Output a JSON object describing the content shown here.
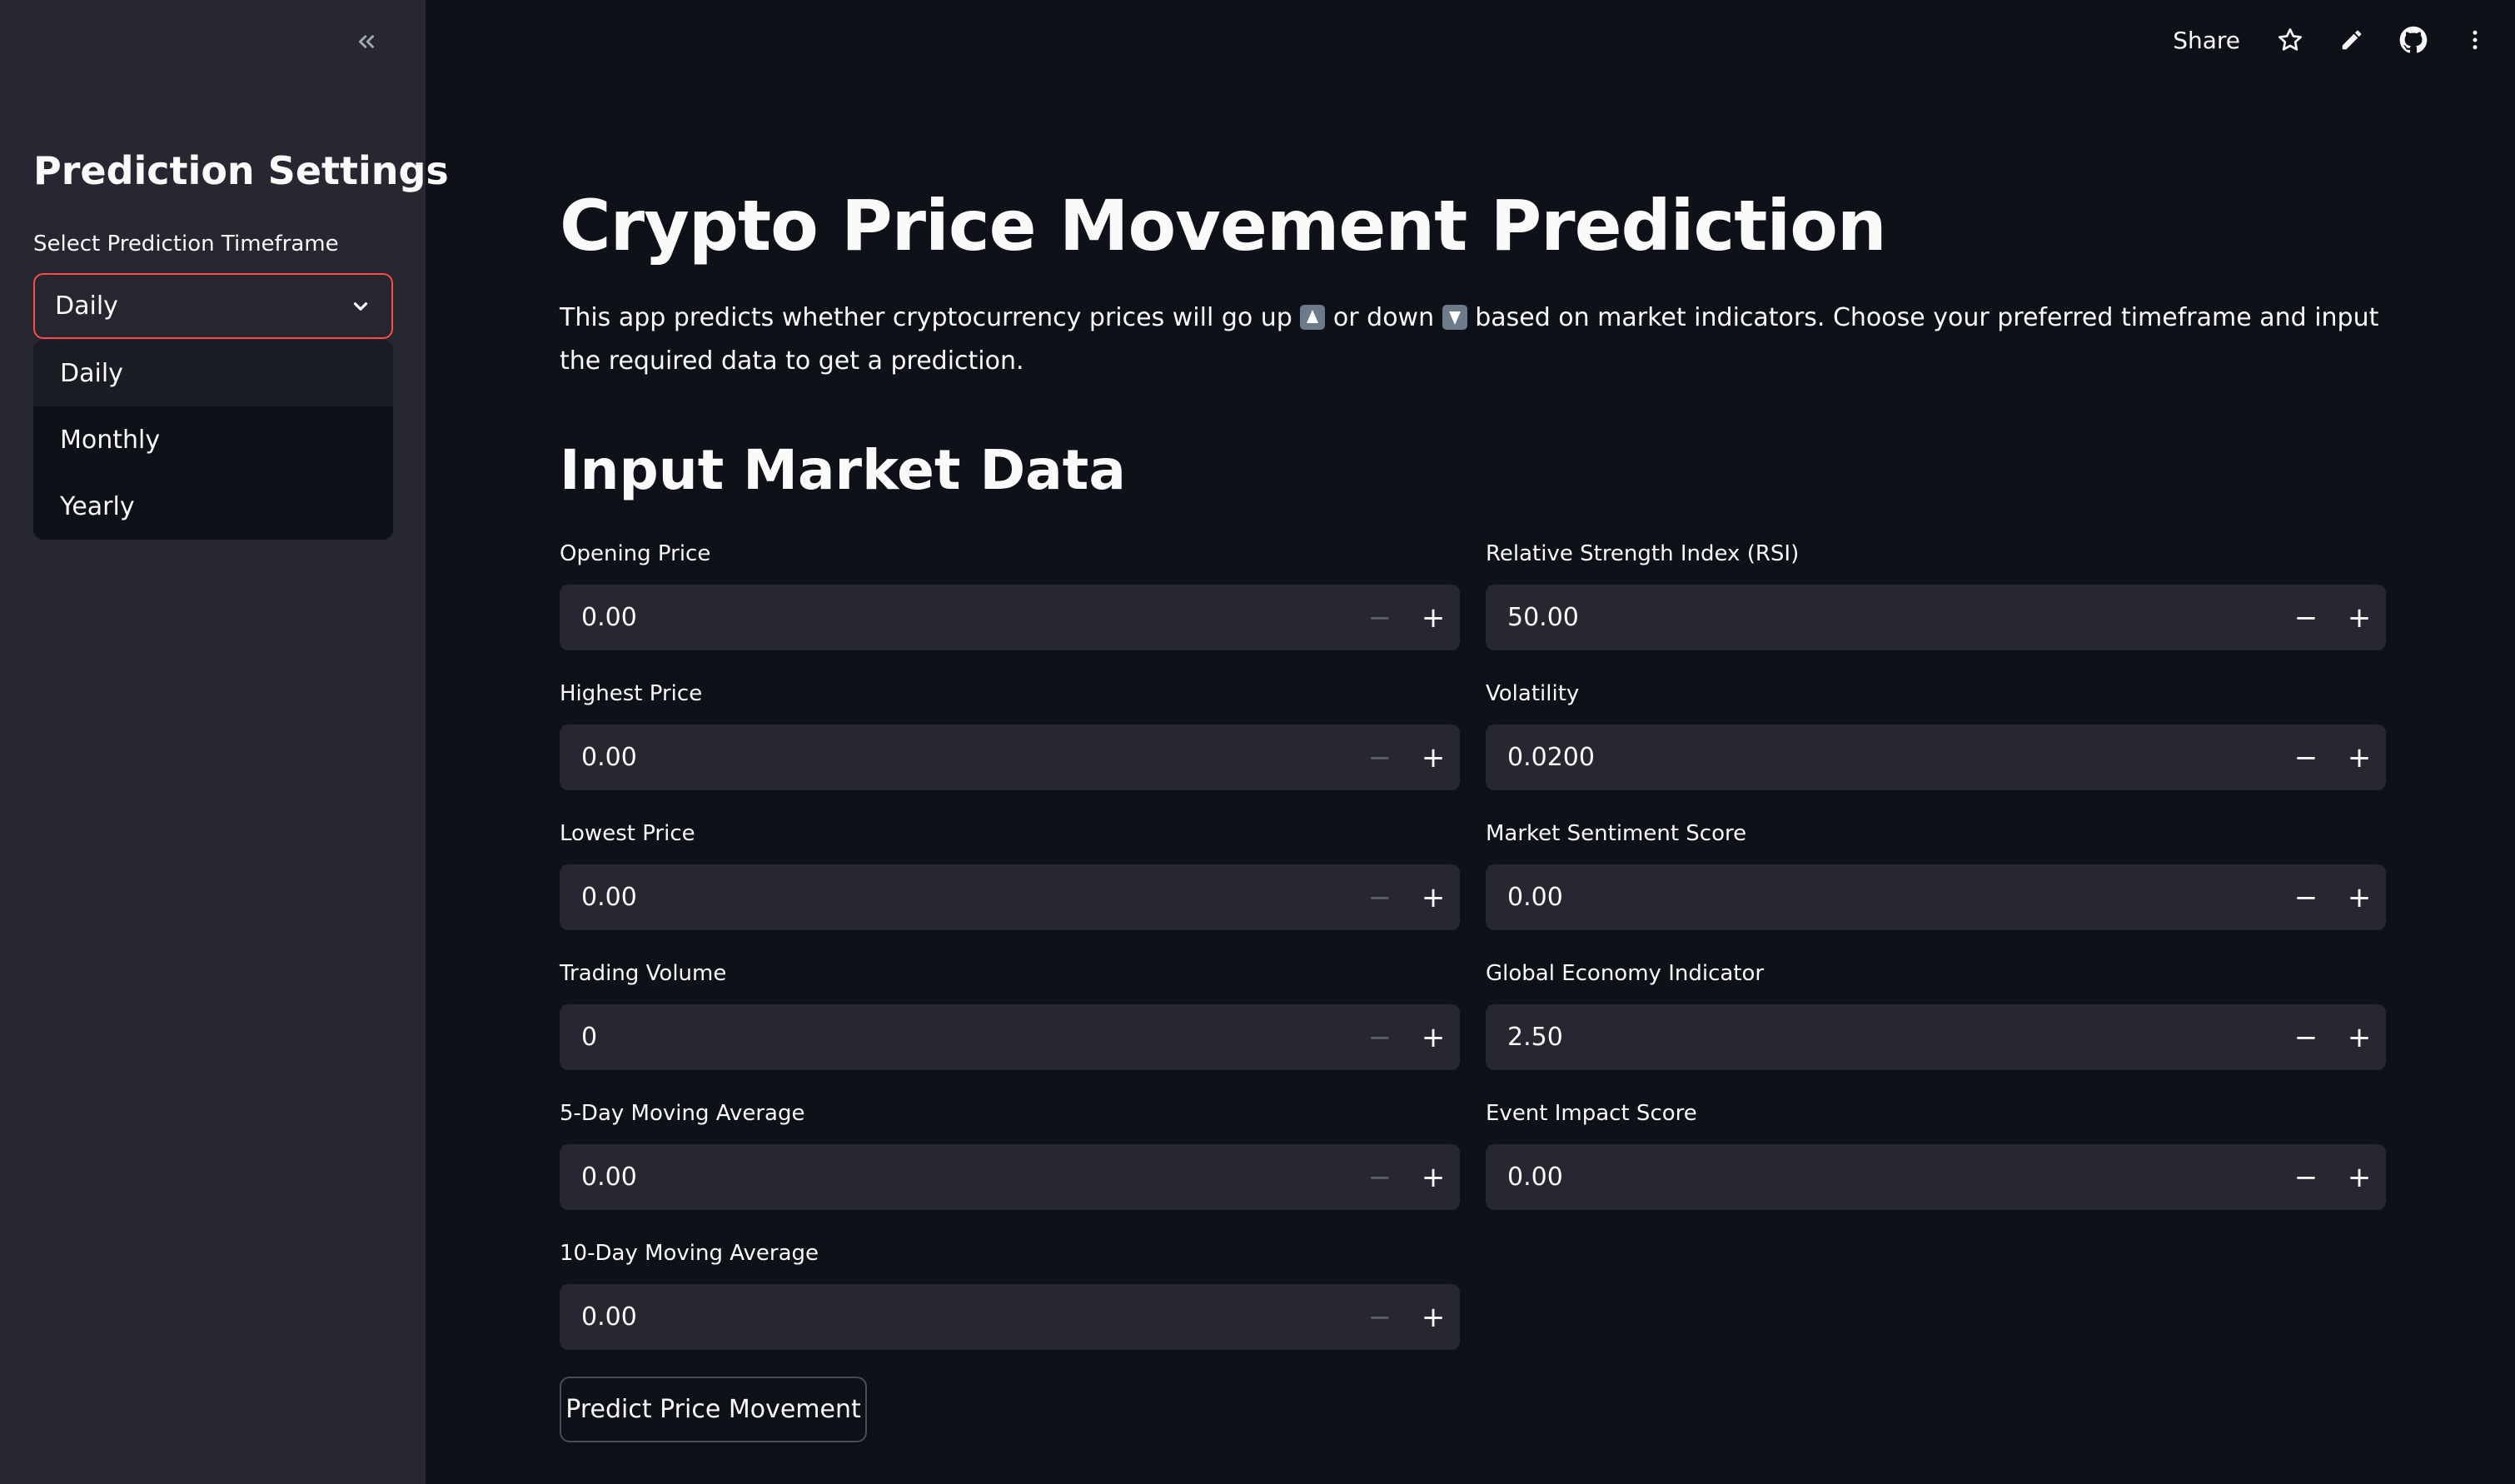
{
  "sidebar": {
    "title": "Prediction Settings",
    "select_label": "Select Prediction Timeframe",
    "selected": "Daily",
    "options": [
      "Daily",
      "Monthly",
      "Yearly"
    ]
  },
  "header": {
    "share_label": "Share",
    "icons": [
      "star-icon",
      "pencil-icon",
      "github-icon",
      "more-vertical-icon"
    ]
  },
  "main": {
    "title": "Crypto Price Movement Prediction",
    "intro_part1": "This app predicts whether cryptocurrency prices will go up",
    "intro_part2": "or down",
    "intro_part3": "based on market indicators. Choose your preferred timeframe and input the required data to get a prediction.",
    "section_title": "Input Market Data",
    "left_fields": [
      {
        "label": "Opening Price",
        "value": "0.00"
      },
      {
        "label": "Highest Price",
        "value": "0.00"
      },
      {
        "label": "Lowest Price",
        "value": "0.00"
      },
      {
        "label": "Trading Volume",
        "value": "0"
      },
      {
        "label": "5-Day Moving Average",
        "value": "0.00"
      },
      {
        "label": "10-Day Moving Average",
        "value": "0.00"
      }
    ],
    "right_fields": [
      {
        "label": "Relative Strength Index (RSI)",
        "value": "50.00"
      },
      {
        "label": "Volatility",
        "value": "0.0200"
      },
      {
        "label": "Market Sentiment Score",
        "value": "0.00"
      },
      {
        "label": "Global Economy Indicator",
        "value": "2.50"
      },
      {
        "label": "Event Impact Score",
        "value": "0.00"
      }
    ],
    "predict_label": "Predict Price Movement"
  },
  "colors": {
    "background": "#0e1117",
    "sidebar": "#262730",
    "accent": "#ff4b4b",
    "input_bg": "#262730"
  }
}
